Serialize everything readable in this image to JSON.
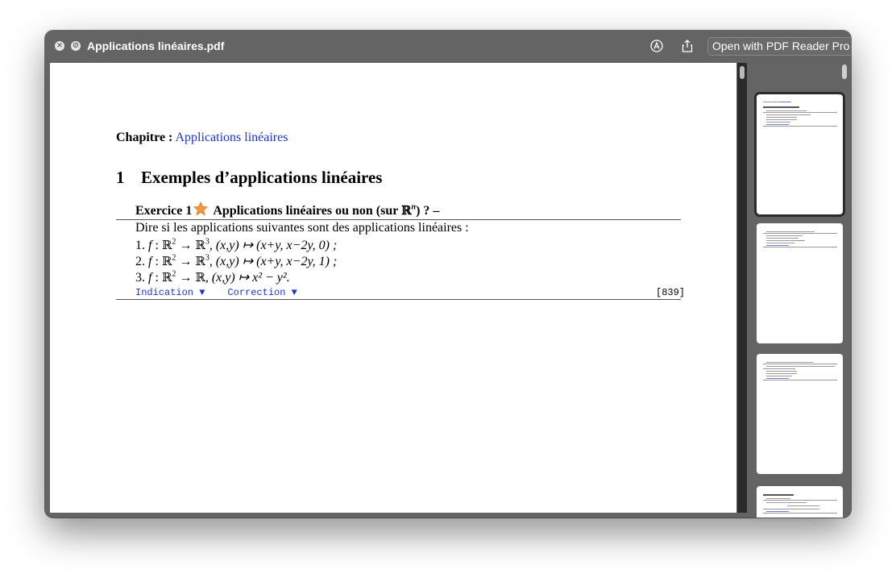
{
  "window": {
    "title": "Applications linéaires.pdf",
    "open_with_label": "Open with PDF Reader Pro",
    "close_symbol": "×",
    "hide_symbol": "⊘"
  },
  "document": {
    "chapter_label": "Chapitre :",
    "chapter_link": "Applications linéaires",
    "section_number": "1",
    "section_title": "Exemples d’applications linéaires",
    "exercise": {
      "label": "Exercice 1",
      "title_pre": "Applications linéaires ou non (sur ",
      "title_ring": "ℝ",
      "title_exp": "n",
      "title_post": ") ? –",
      "intro": "Dire si les applications suivantes sont des applications linéaires :",
      "items": [
        {
          "num": "1.",
          "f": "f",
          "map": " : ",
          "dom": "ℝ",
          "dom_exp": "2",
          "arrow": " → ",
          "cod": "ℝ",
          "cod_exp": "3",
          "rest": ", (x,y) ↦ (x+y, x−2y, 0) ;"
        },
        {
          "num": "2.",
          "f": "f",
          "map": " : ",
          "dom": "ℝ",
          "dom_exp": "2",
          "arrow": " → ",
          "cod": "ℝ",
          "cod_exp": "3",
          "rest": ", (x,y) ↦ (x+y, x−2y, 1) ;"
        },
        {
          "num": "3.",
          "f": "f",
          "map": " : ",
          "dom": "ℝ",
          "dom_exp": "2",
          "arrow": " → ",
          "cod": "ℝ",
          "cod_exp": "",
          "rest": ", (x,y) ↦ x² − y²."
        }
      ],
      "indication_link": "Indication ▼",
      "correction_link": "Correction ▼",
      "reference": "[839]"
    }
  },
  "colors": {
    "link": "#1f33cc",
    "window_bg": "#646464"
  }
}
